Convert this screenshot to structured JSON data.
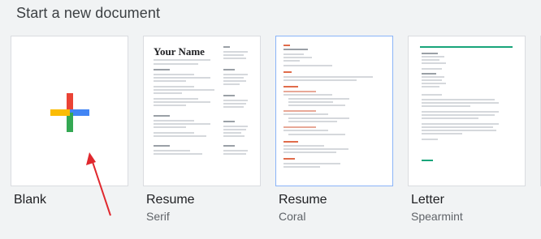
{
  "header": {
    "title": "Start a new document"
  },
  "templates": [
    {
      "title": "Blank",
      "subtitle": ""
    },
    {
      "title": "Resume",
      "subtitle": "Serif",
      "preview_name": "Your Name"
    },
    {
      "title": "Resume",
      "subtitle": "Coral"
    },
    {
      "title": "Letter",
      "subtitle": "Spearmint"
    }
  ],
  "colors": {
    "plus_red": "#ea4335",
    "plus_blue": "#4285f4",
    "plus_green": "#34a853",
    "plus_yellow": "#fbbc04",
    "coral_accent": "#e06c4b",
    "spearmint_accent": "#18a57a",
    "annotation_arrow": "#e0282e"
  },
  "icons": {
    "blank": "plus-icon",
    "annotation": "red-arrow-annotation"
  }
}
